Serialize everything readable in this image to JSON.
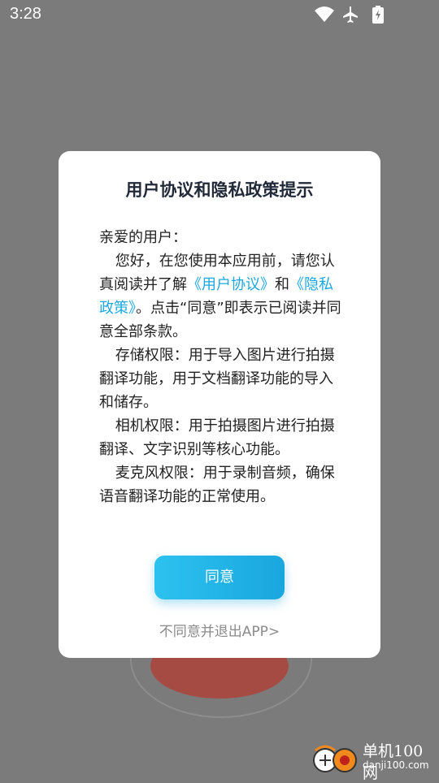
{
  "status_bar": {
    "time": "3:28",
    "icons": [
      "wifi-icon",
      "airplane-mode-icon",
      "battery-charging-icon"
    ]
  },
  "dialog": {
    "title": "用户协议和隐私政策提示",
    "greeting": "亲爱的用户：",
    "intro_prefix": "您好，在您使用本应用前，请您认真阅读并了解",
    "user_agreement_link": "《用户协议》",
    "conjunction": "和",
    "privacy_policy_link": "《隐私政策》",
    "intro_suffix": "。点击“同意”即表示已阅读并同意全部条款。",
    "storage_permission": "存储权限：用于导入图片进行拍摄翻译功能，用于文档翻译功能的导入和储存。",
    "camera_permission": "相机权限：用于拍摄图片进行拍摄翻译、文字识别等核心功能。",
    "microphone_permission": "麦克风权限：用于录制音频，确保语音翻译功能的正常使用。",
    "agree_button": "同意",
    "exit_link": "不同意并退出APP>"
  },
  "watermark": {
    "name": "单机100网",
    "url": "danji100.com"
  },
  "colors": {
    "accent": "#1ba8e0",
    "overlay": "#7b7b7b"
  }
}
